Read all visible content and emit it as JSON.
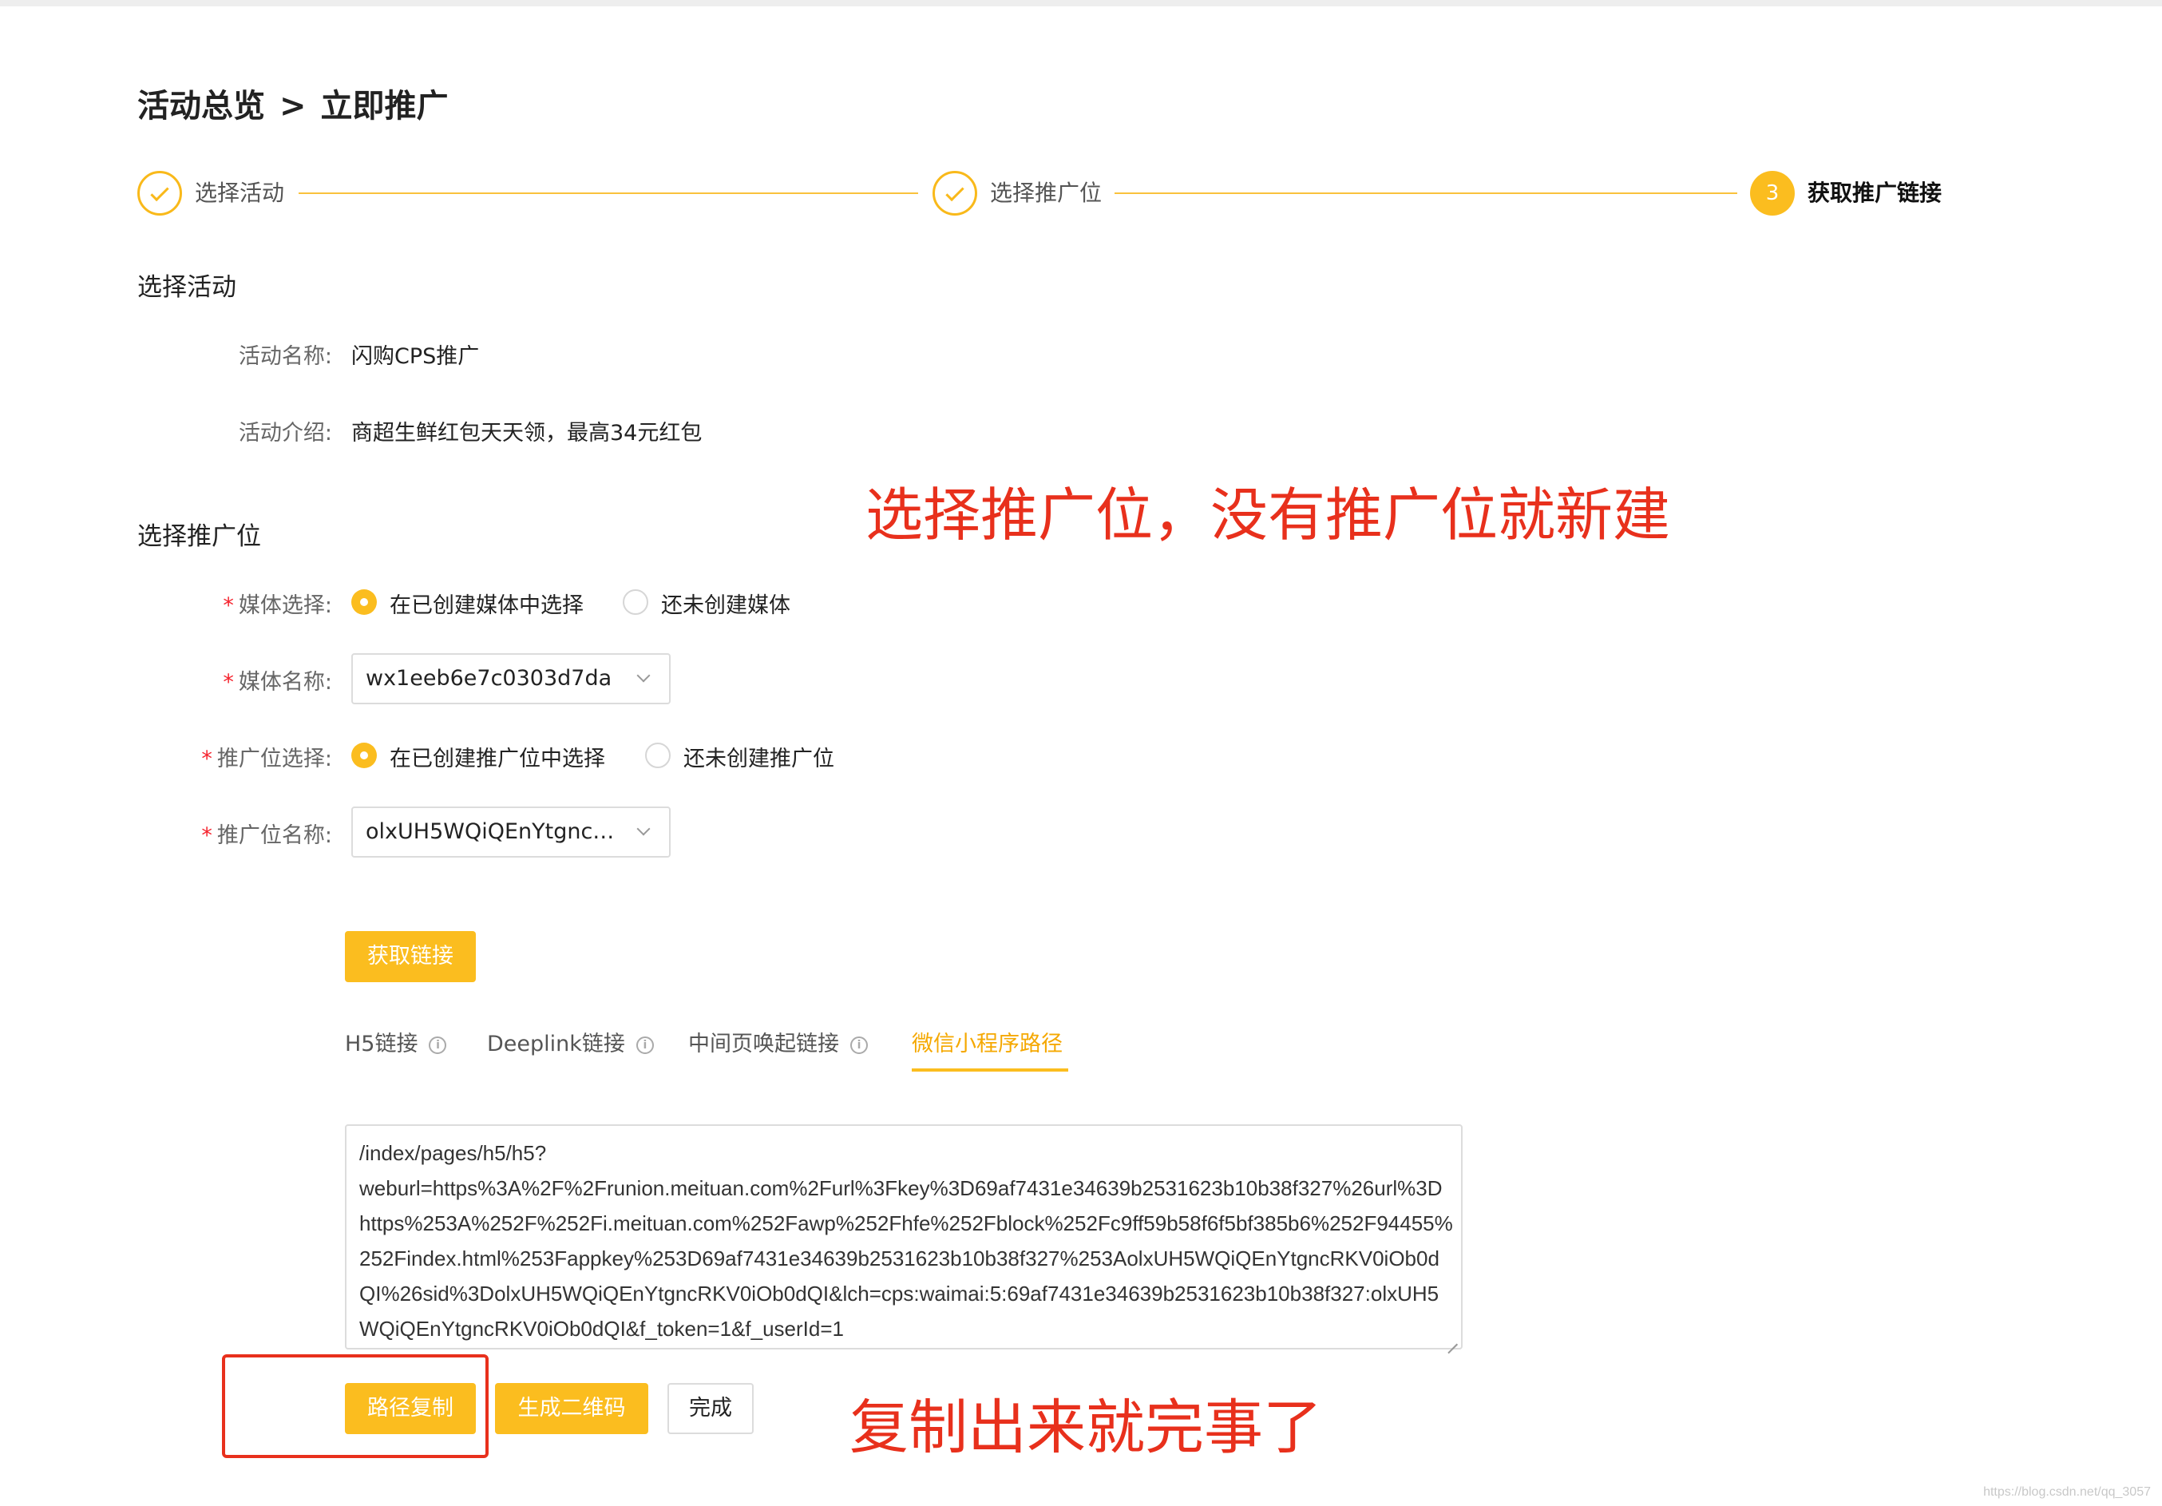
{
  "breadcrumb": {
    "parent": "活动总览",
    "separator": ">",
    "current": "立即推广"
  },
  "steps": [
    {
      "label": "选择活动",
      "status": "done"
    },
    {
      "label": "选择推广位",
      "status": "done"
    },
    {
      "number": "3",
      "label": "获取推广链接",
      "status": "active"
    }
  ],
  "activity": {
    "section_title": "选择活动",
    "name_label": "活动名称:",
    "name_value": "闪购CPS推广",
    "intro_label": "活动介绍:",
    "intro_value": "商超生鲜红包天天领，最高34元红包"
  },
  "promo": {
    "section_title": "选择推广位",
    "media_choice_label": "媒体选择:",
    "media_choice_options": [
      "在已创建媒体中选择",
      "还未创建媒体"
    ],
    "media_name_label": "媒体名称:",
    "media_name_value": "wx1eeb6e7c0303d7da",
    "slot_choice_label": "推广位选择:",
    "slot_choice_options": [
      "在已创建推广位中选择",
      "还未创建推广位"
    ],
    "slot_name_label": "推广位名称:",
    "slot_name_value": "olxUH5WQiQEnYtgncR...",
    "required_mark": "*"
  },
  "get_link_button": "获取链接",
  "tabs": [
    {
      "label": "H5链接",
      "info": "i",
      "active": false
    },
    {
      "label": "Deeplink链接",
      "info": "i",
      "active": false
    },
    {
      "label": "中间页唤起链接",
      "info": "i",
      "active": false
    },
    {
      "label": "微信小程序路径",
      "active": true
    }
  ],
  "path_text": "/index/pages/h5/h5?\nweburl=https%3A%2F%2Frunion.meituan.com%2Furl%3Fkey%3D69af7431e34639b2531623b10b38f327%26url%3Dhttps%253A%252F%252Fi.meituan.com%252Fawp%252Fhfe%252Fblock%252Fc9ff59b58f6f5bf385b6%252F94455%252Findex.html%253Fappkey%253D69af7431e34639b2531623b10b38f327%253AolxUH5WQiQEnYtgncRKV0iOb0dQI%26sid%3DolxUH5WQiQEnYtgncRKV0iOb0dQI&lch=cps:waimai:5:69af7431e34639b2531623b10b38f327:olxUH5WQiQEnYtgncRKV0iOb0dQI&f_token=1&f_userId=1",
  "actions": {
    "copy_path": "路径复制",
    "gen_qr": "生成二维码",
    "done": "完成"
  },
  "annotations": {
    "top": "选择推广位，没有推广位就新建",
    "bottom": "复制出来就完事了",
    "color": "#e8301c"
  },
  "watermark": "https://blog.csdn.net/qq_3057"
}
